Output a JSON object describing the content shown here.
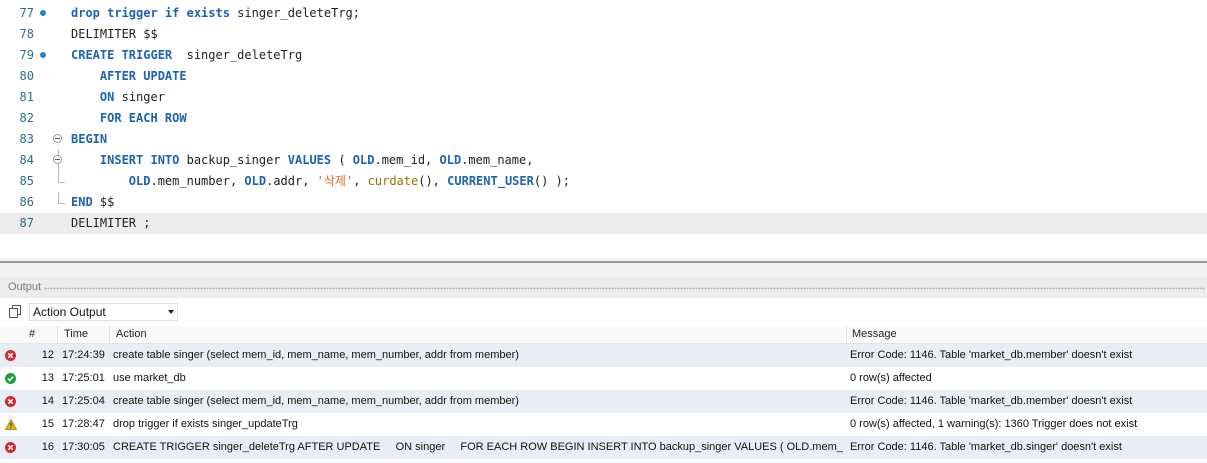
{
  "editor": {
    "lines": [
      {
        "num": "77",
        "marker": true,
        "fold": "",
        "tokens": [
          [
            "kw",
            "drop trigger if exists "
          ],
          [
            "pl",
            "singer_deleteTrg;"
          ]
        ]
      },
      {
        "num": "78",
        "marker": false,
        "fold": "",
        "tokens": [
          [
            "pl",
            "DELIMITER $$"
          ]
        ]
      },
      {
        "num": "79",
        "marker": true,
        "fold": "",
        "tokens": [
          [
            "kw",
            "CREATE TRIGGER"
          ],
          [
            "pl",
            "  singer_deleteTrg"
          ]
        ]
      },
      {
        "num": "80",
        "marker": false,
        "fold": "",
        "tokens": [
          [
            "pl",
            "    "
          ],
          [
            "kw",
            "AFTER UPDATE"
          ]
        ]
      },
      {
        "num": "81",
        "marker": false,
        "fold": "",
        "tokens": [
          [
            "pl",
            "    "
          ],
          [
            "kw",
            "ON "
          ],
          [
            "pl",
            "singer"
          ]
        ]
      },
      {
        "num": "82",
        "marker": false,
        "fold": "",
        "tokens": [
          [
            "pl",
            "    "
          ],
          [
            "kw",
            "FOR EACH ROW"
          ]
        ]
      },
      {
        "num": "83",
        "marker": false,
        "fold": "begin",
        "tokens": [
          [
            "kw",
            "BEGIN"
          ]
        ]
      },
      {
        "num": "84",
        "marker": false,
        "fold": "begin",
        "tokens": [
          [
            "pl",
            "    "
          ],
          [
            "kw",
            "INSERT INTO "
          ],
          [
            "pl",
            "backup_singer "
          ],
          [
            "kw",
            "VALUES "
          ],
          [
            "pl",
            "( "
          ],
          [
            "kw",
            "OLD"
          ],
          [
            "pl",
            ".mem_id, "
          ],
          [
            "kw",
            "OLD"
          ],
          [
            "pl",
            ".mem_name,"
          ]
        ]
      },
      {
        "num": "85",
        "marker": false,
        "fold": "end",
        "tokens": [
          [
            "pl",
            "        "
          ],
          [
            "kw",
            "OLD"
          ],
          [
            "pl",
            ".mem_number, "
          ],
          [
            "kw",
            "OLD"
          ],
          [
            "pl",
            ".addr, "
          ],
          [
            "str",
            "'삭제'"
          ],
          [
            "pl",
            ", "
          ],
          [
            "fn",
            "curdate"
          ],
          [
            "pl",
            "(), "
          ],
          [
            "kw",
            "CURRENT_USER"
          ],
          [
            "pl",
            "() );"
          ]
        ]
      },
      {
        "num": "86",
        "marker": false,
        "fold": "end",
        "tokens": [
          [
            "kw",
            "END "
          ],
          [
            "pl",
            "$$"
          ]
        ]
      },
      {
        "num": "87",
        "marker": false,
        "fold": "",
        "current": true,
        "tokens": [
          [
            "pl",
            "DELIMITER ;"
          ]
        ]
      }
    ]
  },
  "output": {
    "title": "Output",
    "selector_value": "Action Output",
    "columns": {
      "num": "#",
      "time": "Time",
      "action": "Action",
      "message": "Message"
    },
    "rows": [
      {
        "status": "error",
        "num": "12",
        "time": "17:24:39",
        "action": "create table singer (select mem_id, mem_name, mem_number, addr from member)",
        "message": "Error Code: 1146. Table 'market_db.member' doesn't exist"
      },
      {
        "status": "success",
        "num": "13",
        "time": "17:25:01",
        "action": "use market_db",
        "message": "0 row(s) affected"
      },
      {
        "status": "error",
        "num": "14",
        "time": "17:25:04",
        "action": "create table singer (select mem_id, mem_name, mem_number, addr from member)",
        "message": "Error Code: 1146. Table 'market_db.member' doesn't exist"
      },
      {
        "status": "warning",
        "num": "15",
        "time": "17:28:47",
        "action": "drop trigger if exists singer_updateTrg",
        "message": "0 row(s) affected, 1 warning(s): 1360 Trigger does not exist"
      },
      {
        "status": "error",
        "num": "16",
        "time": "17:30:05",
        "action": "CREATE TRIGGER singer_deleteTrg AFTER UPDATE     ON singer     FOR EACH ROW BEGIN INSERT INTO backup_singer VALUES ( OLD.mem_id...",
        "message": "Error Code: 1146. Table 'market_db.singer' doesn't exist"
      }
    ]
  },
  "colors": {
    "error": "#d9262b",
    "success": "#1f9d3a",
    "warning": "#e8b815",
    "keyword": "#1c63b3",
    "line_number": "#2b6f8e"
  }
}
